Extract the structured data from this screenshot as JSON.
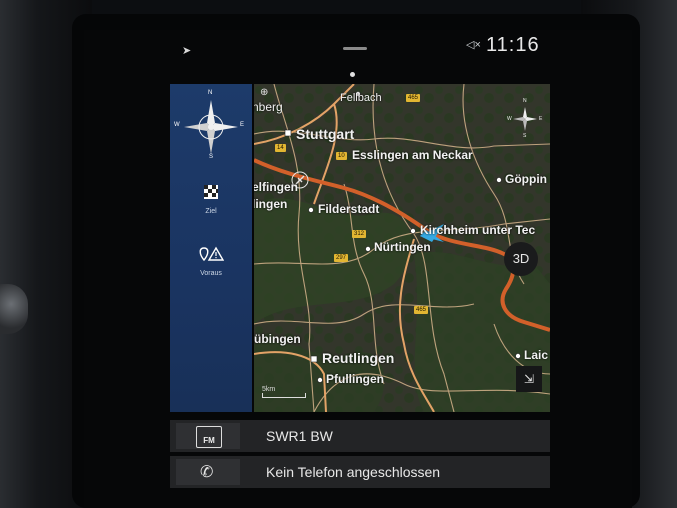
{
  "status": {
    "time": "11:16",
    "mute_icon": "speaker-mute-icon",
    "nav_icon": "navigation-arrow-icon"
  },
  "sidebar": {
    "compass": {
      "n": "N",
      "s": "S",
      "e": "E",
      "w": "W"
    },
    "items": [
      {
        "label": "Ziel",
        "icon": "checkered-flag-icon"
      },
      {
        "label": "Voraus",
        "icon": "route-warning-icon"
      }
    ]
  },
  "map": {
    "places": [
      {
        "name": "nberg"
      },
      {
        "name": "Fellbach"
      },
      {
        "name": "Stuttgart"
      },
      {
        "name": "Esslingen am Neckar"
      },
      {
        "name": "Göppin"
      },
      {
        "name": "elfingen"
      },
      {
        "name": "lingen"
      },
      {
        "name": "Filderstadt"
      },
      {
        "name": "Kirchheim unter Tec"
      },
      {
        "name": "Nürtingen"
      },
      {
        "name": "übingen"
      },
      {
        "name": "Reutlingen"
      },
      {
        "name": "Pfullingen"
      },
      {
        "name": "Laic"
      }
    ],
    "road_shields": [
      "14",
      "10",
      "313",
      "312",
      "297",
      "465"
    ],
    "compass": {
      "n": "N",
      "s": "S",
      "e": "E",
      "w": "W"
    },
    "btn_3d": "3D",
    "expand_icon": "expand-arrow-icon",
    "scale": "5km",
    "colors": {
      "route": "#d2602a",
      "vehicle": "#35a9e3",
      "sidebar": "#1d3b6a"
    }
  },
  "media": {
    "source": "FM",
    "station": "SWR1 BW"
  },
  "phone": {
    "status": "Kein Telefon angeschlossen"
  }
}
